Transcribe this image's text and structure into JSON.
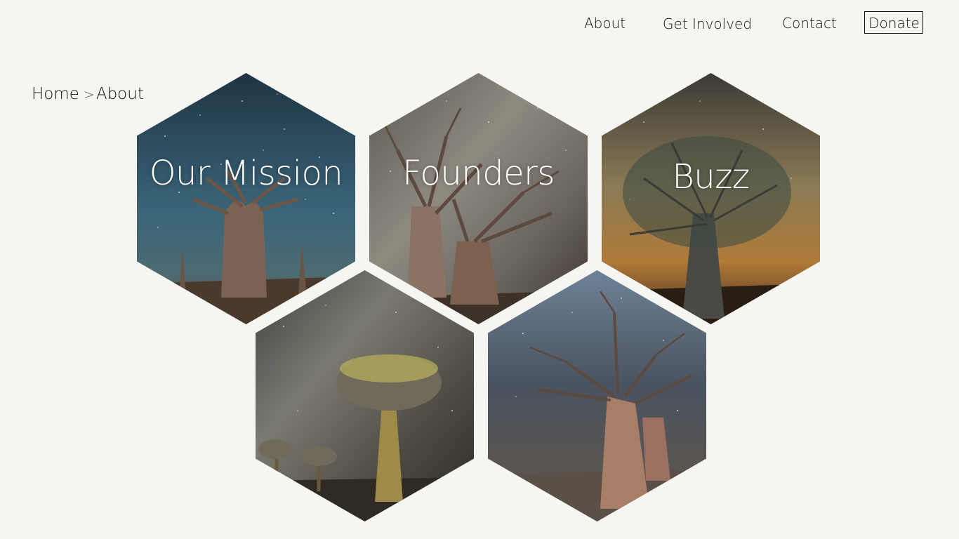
{
  "nav": {
    "about": "About",
    "get_involved": "Get Involved",
    "contact": "Contact",
    "donate": "Donate"
  },
  "breadcrumb": {
    "home": "Home",
    "separator": ">",
    "current": "About"
  },
  "tiles": [
    {
      "label": "Our Mission",
      "image": "baobab-starry-night"
    },
    {
      "label": "Founders",
      "image": "baobabs-milky-way"
    },
    {
      "label": "Buzz",
      "image": "baobab-golden-sky"
    },
    {
      "label": "",
      "image": "quiver-tree-milky-way"
    },
    {
      "label": "",
      "image": "baobab-night-sky"
    }
  ],
  "colors": {
    "background": "#f5f5f1",
    "text": "#111111",
    "tile_label": "#ffffff"
  }
}
